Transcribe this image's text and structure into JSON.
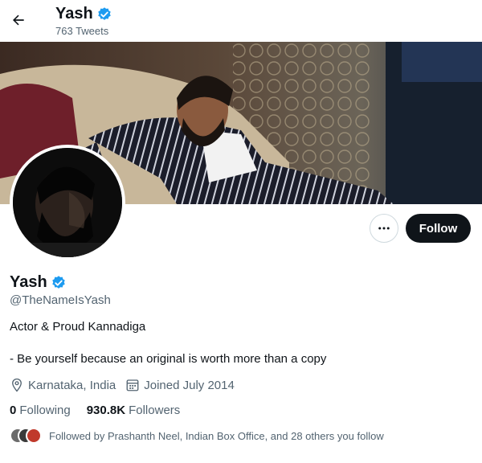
{
  "header": {
    "name": "Yash",
    "tweets_count": "763 Tweets"
  },
  "profile": {
    "name": "Yash",
    "handle": "@TheNameIsYash",
    "bio_line1": "Actor & Proud Kannadiga",
    "bio_line2": "- Be yourself because an original is worth more than a copy",
    "location": "Karnataka, India",
    "joined": "Joined July 2014",
    "following_count": "0",
    "following_label": "Following",
    "followers_count": "930.8K",
    "followers_label": "Followers",
    "followed_by": "Followed by Prashanth Neel, Indian Box Office, and 28 others you follow"
  },
  "actions": {
    "follow_label": "Follow"
  },
  "colors": {
    "verified": "#1d9bf0",
    "primary_text": "#0f1419",
    "secondary_text": "#536471",
    "follow_bg": "#0f1419"
  },
  "icons": [
    "back-arrow-icon",
    "verified-badge-icon",
    "more-options-icon",
    "location-pin-icon",
    "calendar-icon"
  ]
}
